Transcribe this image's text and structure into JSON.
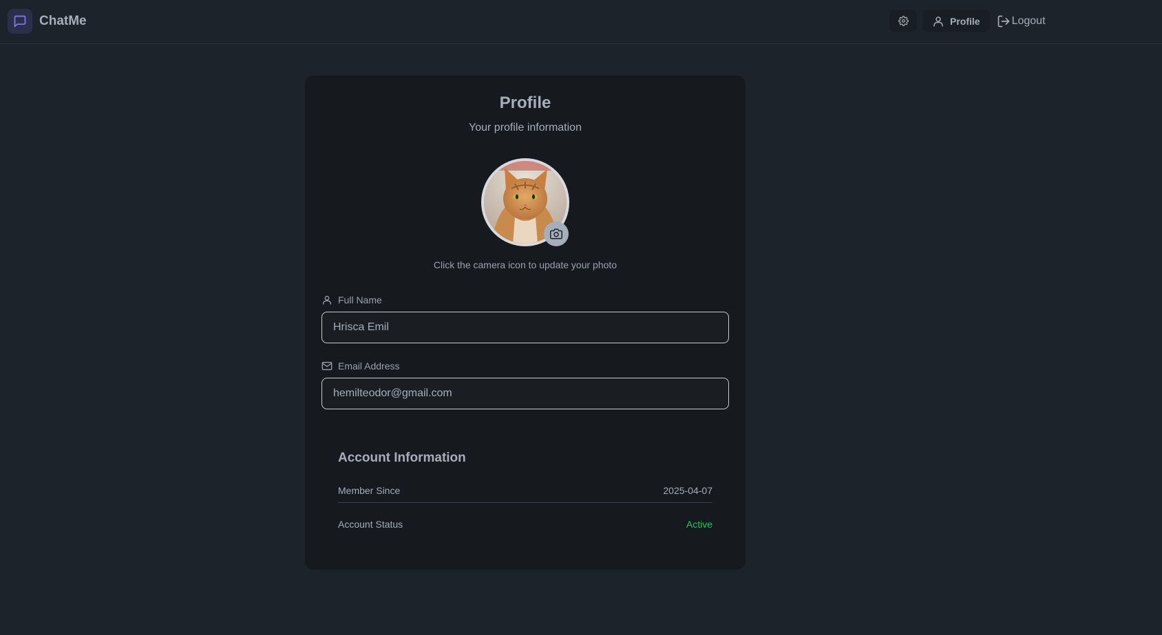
{
  "app": {
    "name": "ChatMe"
  },
  "nav": {
    "profile_label": "Profile",
    "logout_label": "Logout"
  },
  "profile": {
    "title": "Profile",
    "subtitle": "Your profile information",
    "photo_hint": "Click the camera icon to update your photo",
    "full_name_label": "Full Name",
    "full_name_value": "Hrisca Emil",
    "email_label": "Email Address",
    "email_value": "hemilteodor@gmail.com"
  },
  "account": {
    "title": "Account Information",
    "member_since_label": "Member Since",
    "member_since_value": "2025-04-07",
    "status_label": "Account Status",
    "status_value": "Active"
  },
  "colors": {
    "background": "#1d232a",
    "card": "#16191e",
    "accent": "#6366f1",
    "status_active": "#22c55e"
  },
  "icons": {
    "brand": "message-square-icon",
    "settings": "gear-icon",
    "profile": "user-icon",
    "logout": "log-out-icon",
    "camera": "camera-icon",
    "full_name": "user-icon",
    "email": "mail-icon"
  }
}
